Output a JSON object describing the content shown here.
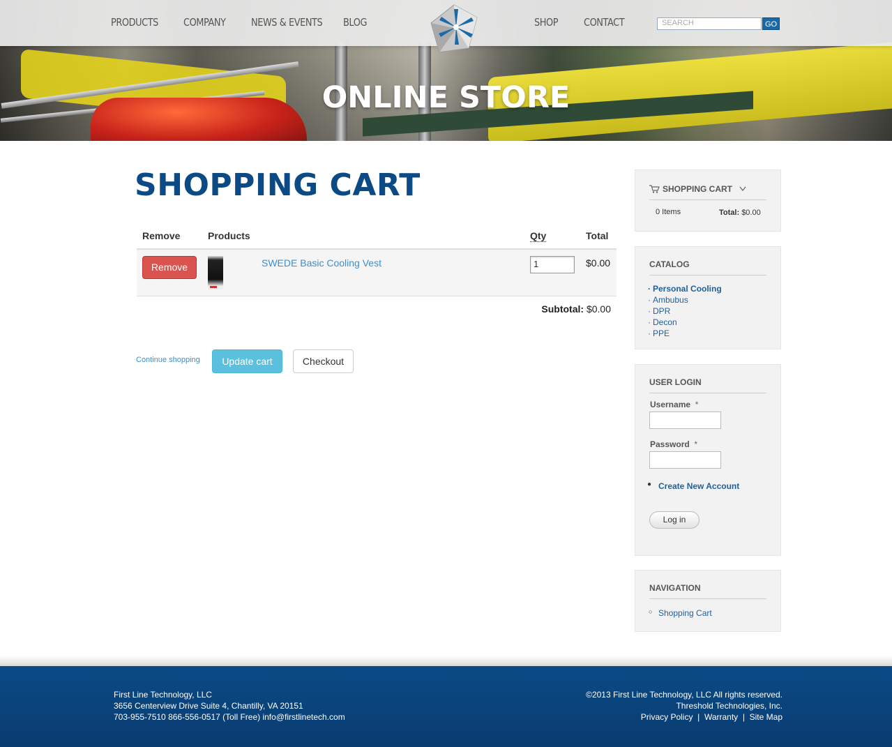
{
  "header": {
    "nav_left": [
      "PRODUCTS",
      "COMPANY",
      "NEWS & EVENTS",
      "BLOG"
    ],
    "nav_right": [
      "SHOP",
      "CONTACT"
    ],
    "search": {
      "placeholder": "SEARCH",
      "button": "GO"
    }
  },
  "hero": {
    "title": "ONLINE STORE"
  },
  "main": {
    "title": "SHOPPING CART",
    "table": {
      "headers": {
        "remove": "Remove",
        "products": "Products",
        "qty": "Qty",
        "total": "Total"
      },
      "rows": [
        {
          "remove_label": "Remove",
          "product": "SWEDE Basic Cooling Vest",
          "qty": "1",
          "total": "$0.00"
        }
      ],
      "subtotal_label": "Subtotal:",
      "subtotal_value": "$0.00"
    },
    "actions": {
      "continue": "Continue shopping",
      "update": "Update cart",
      "checkout": "Checkout"
    }
  },
  "sidebar": {
    "cart": {
      "title": "SHOPPING CART",
      "items": "0 Items",
      "total_label": "Total:",
      "total_value": "$0.00"
    },
    "catalog": {
      "title": "CATALOG",
      "items": [
        "Personal Cooling",
        "Ambubus",
        "DPR",
        "Decon",
        "PPE"
      ]
    },
    "login": {
      "title": "USER LOGIN",
      "username_label": "Username",
      "password_label": "Password",
      "required_mark": "*",
      "create_account": "Create New Account",
      "login_button": "Log in"
    },
    "navigation": {
      "title": "NAVIGATION",
      "items": [
        "Shopping Cart"
      ]
    }
  },
  "footer": {
    "left": [
      "First Line Technology, LLC",
      "3656 Centerview Drive Suite 4, Chantilly, VA 20151",
      "703-955-7510  866-556-0517 (Toll Free)  info@firstlinetech.com"
    ],
    "copyright": "©2013 First Line Technology, LLC All rights reserved.",
    "credit": "Threshold Technologies, Inc.",
    "links": [
      "Privacy Policy",
      "Warranty",
      "Site Map"
    ],
    "separator": "|"
  },
  "colors": {
    "brand_blue": "#0b4a85",
    "link_blue": "#3a8fd0",
    "remove_red": "#d9534f",
    "update_cyan": "#5bc0de"
  }
}
